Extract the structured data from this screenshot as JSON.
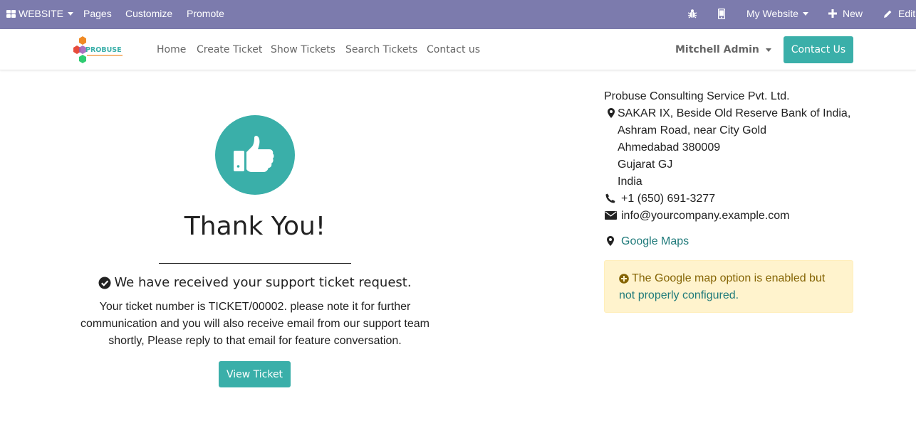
{
  "adminbar": {
    "website_label": "WEBSITE",
    "pages_label": "Pages",
    "customize_label": "Customize",
    "promote_label": "Promote",
    "mywebsite_label": "My Website",
    "new_label": "New",
    "edit_label": "Edit"
  },
  "header": {
    "logo_text": "PROBUSE",
    "nav": [
      "Home",
      "Create Ticket",
      "Show Tickets",
      "Search Tickets",
      "Contact us"
    ],
    "user_label": "Mitchell Admin",
    "contact_button": "Contact Us"
  },
  "main": {
    "title": "Thank You!",
    "received_text": "We have received your support ticket request.",
    "message_lines": [
      "Your ticket number is TICKET/00002. please note it for further",
      "communication and you will also receive email from our support team",
      "shortly, Please reply to that email for feature conversation."
    ],
    "view_button": "View Ticket"
  },
  "company": {
    "name": "Probuse Consulting Service Pvt. Ltd.",
    "address_lines": [
      "SAKAR IX, Beside Old Reserve Bank of India,",
      "Ashram Road, near City Gold",
      "Ahmedabad 380009",
      "Gujarat GJ",
      "India"
    ],
    "phone": "+1 (650) 691-3277",
    "email": "info@yourcompany.example.com",
    "maps_link": "Google Maps",
    "alert_text": "The Google map option is enabled but",
    "alert_link": "not properly configured."
  },
  "colors": {
    "admin_bar": "#7c7bad",
    "accent": "#3aafa9",
    "alert_bg": "#fff3cd",
    "alert_text": "#856404"
  }
}
